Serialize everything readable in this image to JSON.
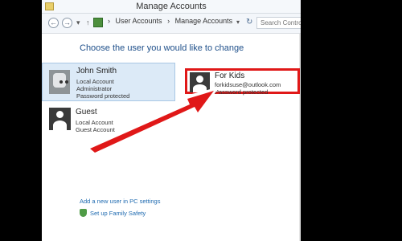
{
  "window": {
    "title": "Manage Accounts"
  },
  "breadcrumb": [
    "User Accounts",
    "Manage Accounts"
  ],
  "search": {
    "placeholder": "Search Control Panel"
  },
  "main": {
    "title": "Choose the user you would like to change"
  },
  "accounts": [
    {
      "name": "John Smith",
      "type": "Local Account",
      "role": "Administrator",
      "status": "Password protected"
    },
    {
      "name": "For Kids",
      "email": "forkidsuse@outlook.com",
      "status": "Password protected"
    },
    {
      "name": "Guest",
      "type": "Local Account",
      "status": "Guest Account"
    }
  ],
  "links": {
    "add_user": "Add a new user in PC settings",
    "family_safety": "Set up Family Safety"
  },
  "colors": {
    "highlight": "#e01818",
    "title_blue": "#1e4f8a",
    "link_blue": "#1e6ab0"
  }
}
